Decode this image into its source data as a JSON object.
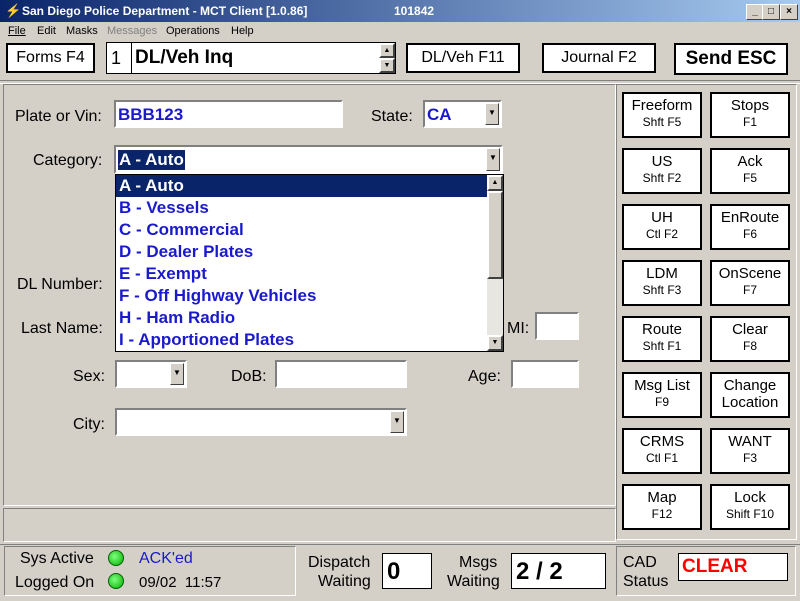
{
  "window": {
    "title": "San Diego Police Department - MCT Client [1.0.86]",
    "id_number": "101842"
  },
  "menu": [
    "File",
    "Edit",
    "Masks",
    "Messages",
    "Operations",
    "Help"
  ],
  "toolbar": {
    "forms_label": "Forms F4",
    "mask_number": "1",
    "mask_name": "DL/Veh Inq",
    "dlveh_label": "DL/Veh F11",
    "journal_label": "Journal F2",
    "send_label": "Send ESC"
  },
  "form": {
    "plate_label": "Plate or Vin:",
    "plate_value": "BBB123",
    "state_label": "State:",
    "state_value": "CA",
    "category_label": "Category:",
    "category_value": "A - Auto",
    "category_options": [
      "A - Auto",
      "B - Vessels",
      "C - Commercial",
      "D - Dealer Plates",
      "E - Exempt",
      "F - Off Highway Vehicles",
      "H - Ham Radio",
      "I - Apportioned Plates"
    ],
    "dl_label": "DL Number:",
    "lastname_label": "Last Name:",
    "mi_label": "MI:",
    "sex_label": "Sex:",
    "dob_label": "DoB:",
    "age_label": "Age:",
    "city_label": "City:"
  },
  "side_buttons": [
    {
      "a": "Freeform",
      "b": "Shft F5"
    },
    {
      "a": "Stops",
      "b": "F1"
    },
    {
      "a": "US",
      "b": "Shft F2"
    },
    {
      "a": "Ack",
      "b": "F5"
    },
    {
      "a": "UH",
      "b": "Ctl F2"
    },
    {
      "a": "EnRoute",
      "b": "F6"
    },
    {
      "a": "LDM",
      "b": "Shft F3"
    },
    {
      "a": "OnScene",
      "b": "F7"
    },
    {
      "a": "Route",
      "b": "Shft F1"
    },
    {
      "a": "Clear",
      "b": "F8"
    },
    {
      "a": "Msg List",
      "b": "F9"
    },
    {
      "a": "Change",
      "b": "Location"
    },
    {
      "a": "CRMS",
      "b": "Ctl F1"
    },
    {
      "a": "WANT",
      "b": "F3"
    },
    {
      "a": "Map",
      "b": "F12"
    },
    {
      "a": "Lock",
      "b": "Shift F10"
    }
  ],
  "status": {
    "sys_active_label": "Sys Active",
    "logged_on_label": "Logged On",
    "ack_text": "ACK'ed",
    "date_time": "09/02  11:57",
    "dispatch_label_1": "Dispatch",
    "dispatch_label_2": "Waiting",
    "dispatch_value": "0",
    "msgs_label_1": "Msgs",
    "msgs_label_2": "Waiting",
    "msgs_value": "2 / 2",
    "cad_label_1": "CAD",
    "cad_label_2": "Status",
    "cad_value": "CLEAR",
    "led_color": "#00c000",
    "cad_color": "#ff0000"
  }
}
